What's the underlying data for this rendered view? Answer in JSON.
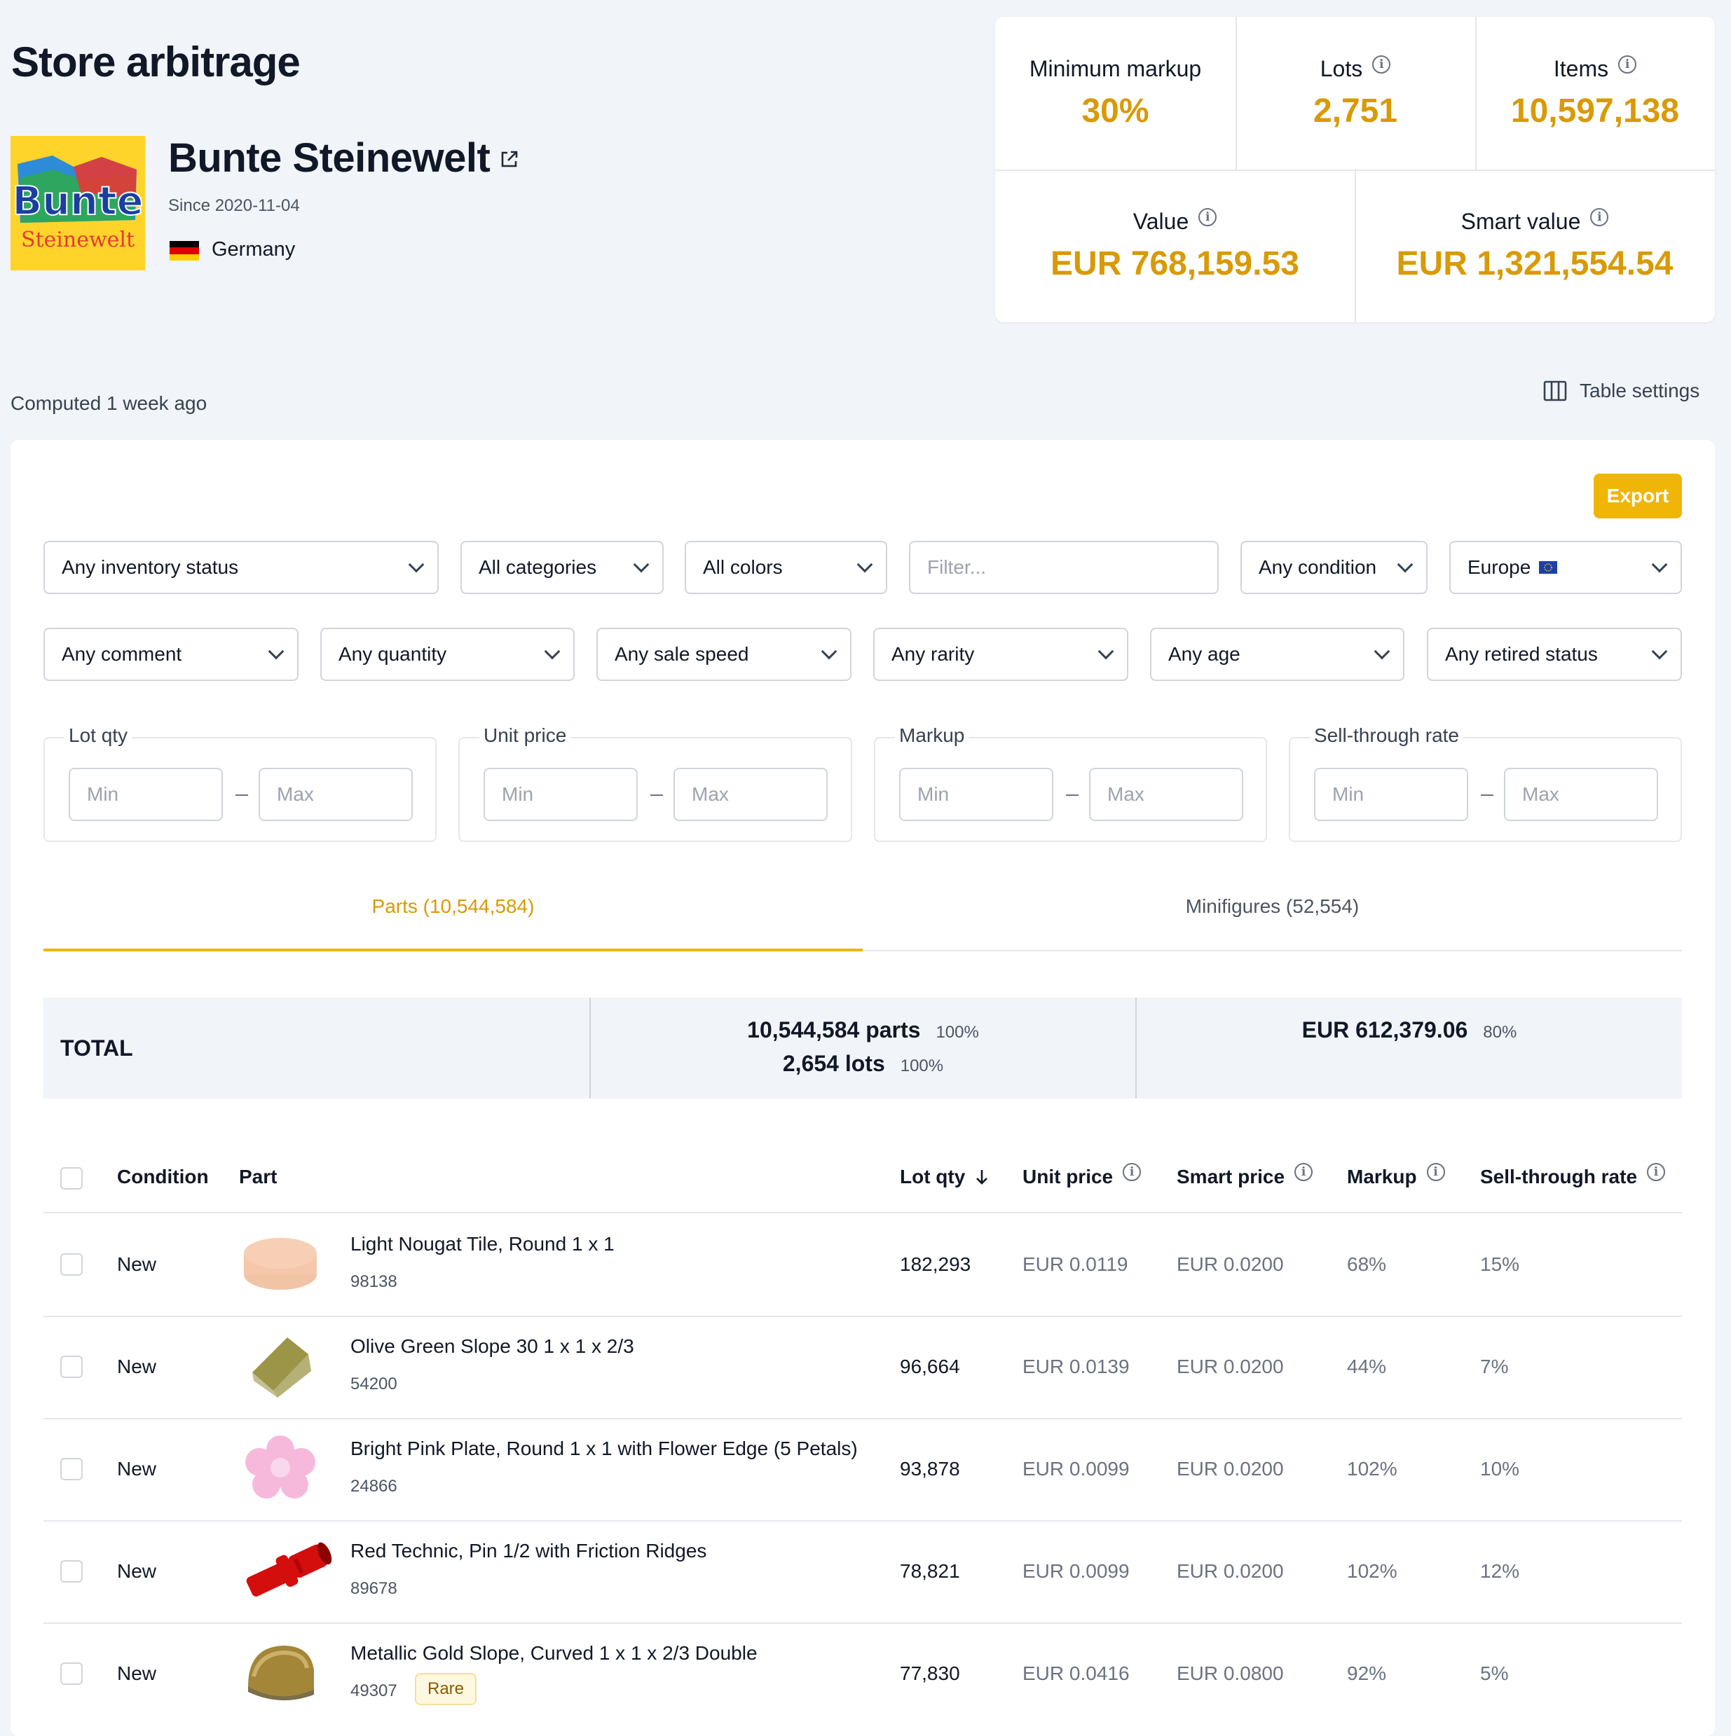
{
  "page": {
    "title": "Store arbitrage"
  },
  "store": {
    "name": "Bunte Steinewelt",
    "since": "Since 2020-11-04",
    "country": "Germany",
    "logo_text_1": "Bunte",
    "logo_text_2": "Steinewelt"
  },
  "stats": {
    "min_markup": {
      "label": "Minimum markup",
      "value": "30%"
    },
    "lots": {
      "label": "Lots",
      "value": "2,751"
    },
    "items": {
      "label": "Items",
      "value": "10,597,138"
    },
    "value": {
      "label": "Value",
      "value": "EUR 768,159.53"
    },
    "smart_value": {
      "label": "Smart value",
      "value": "EUR 1,321,554.54"
    }
  },
  "computed": "Computed 1 week ago",
  "table_settings": "Table settings",
  "export_label": "Export",
  "filters": {
    "inventory_status": "Any inventory status",
    "categories": "All categories",
    "colors": "All colors",
    "filter_placeholder": "Filter...",
    "condition": "Any condition",
    "region": "Europe",
    "comment": "Any comment",
    "quantity": "Any quantity",
    "sale_speed": "Any sale speed",
    "rarity": "Any rarity",
    "age": "Any age",
    "retired_status": "Any retired status"
  },
  "ranges": {
    "min": "Min",
    "max": "Max",
    "lot_qty": "Lot qty",
    "unit_price": "Unit price",
    "markup": "Markup",
    "sell_through": "Sell-through rate"
  },
  "tabs": {
    "parts": "Parts (10,544,584)",
    "minifigures": "Minifigures (52,554)"
  },
  "total": {
    "label": "TOTAL",
    "parts": "10,544,584 parts",
    "parts_pct": "100%",
    "lots": "2,654 lots",
    "lots_pct": "100%",
    "value": "EUR 612,379.06",
    "value_pct": "80%"
  },
  "columns": {
    "condition": "Condition",
    "part": "Part",
    "lot_qty": "Lot qty",
    "unit_price": "Unit price",
    "smart_price": "Smart price",
    "markup": "Markup",
    "sell_through": "Sell-through rate"
  },
  "rows": [
    {
      "condition": "New",
      "name": "Light Nougat Tile, Round 1 x 1",
      "number": "98138",
      "qty": "182,293",
      "unit": "EUR 0.0119",
      "smart": "EUR 0.0200",
      "markup": "68%",
      "str": "15%",
      "color": "#f6c7a8"
    },
    {
      "condition": "New",
      "name": "Olive Green Slope 30 1 x 1 x 2/3",
      "number": "54200",
      "qty": "96,664",
      "unit": "EUR 0.0139",
      "smart": "EUR 0.0200",
      "markup": "44%",
      "str": "7%",
      "color": "#9c9548"
    },
    {
      "condition": "New",
      "name": "Bright Pink Plate, Round 1 x 1 with Flower Edge (5 Petals)",
      "number": "24866",
      "qty": "93,878",
      "unit": "EUR 0.0099",
      "smart": "EUR 0.0200",
      "markup": "102%",
      "str": "10%",
      "color": "#f6b9dc"
    },
    {
      "condition": "New",
      "name": "Red Technic, Pin 1/2 with Friction Ridges",
      "number": "89678",
      "qty": "78,821",
      "unit": "EUR 0.0099",
      "smart": "EUR 0.0200",
      "markup": "102%",
      "str": "12%",
      "color": "#d40d0d"
    },
    {
      "condition": "New",
      "name": "Metallic Gold Slope, Curved 1 x 1 x 2/3 Double",
      "number": "49307",
      "badge": "Rare",
      "qty": "77,830",
      "unit": "EUR 0.0416",
      "smart": "EUR 0.0800",
      "markup": "92%",
      "str": "5%",
      "color": "#a38637"
    }
  ]
}
